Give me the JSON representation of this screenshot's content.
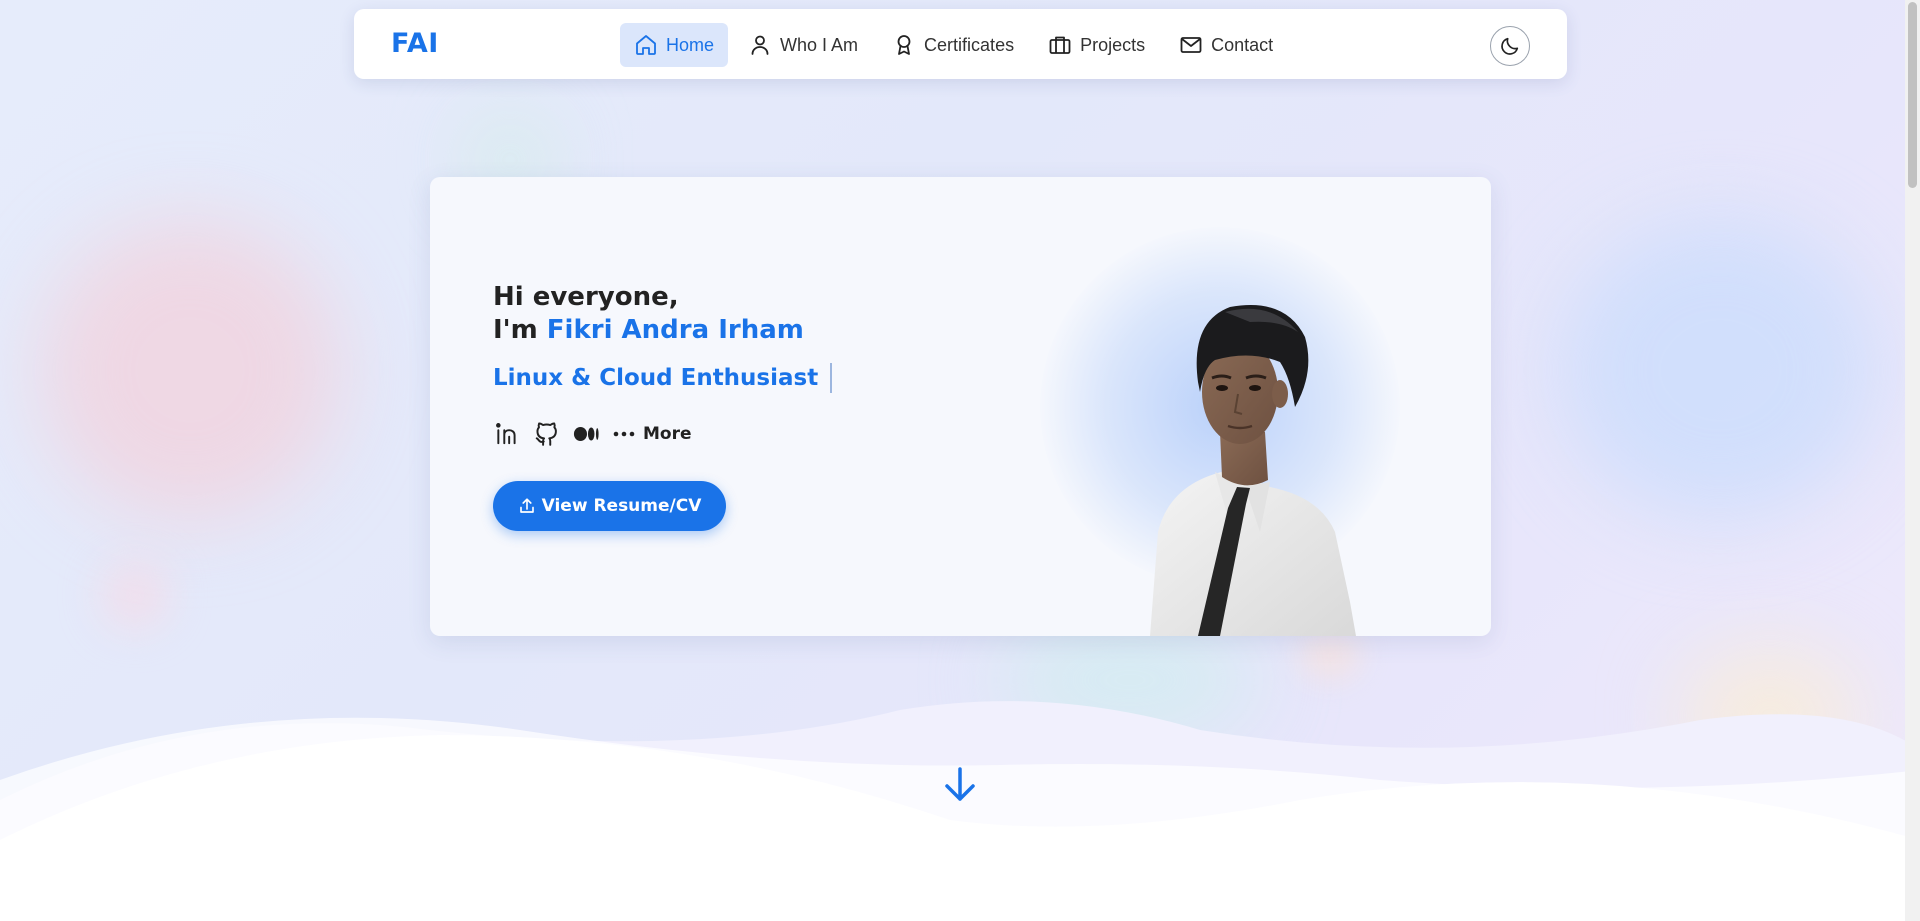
{
  "brand": "FAI",
  "nav": {
    "items": [
      {
        "label": "Home",
        "icon": "home-icon",
        "active": true
      },
      {
        "label": "Who I Am",
        "icon": "user-icon",
        "active": false
      },
      {
        "label": "Certificates",
        "icon": "award-icon",
        "active": false
      },
      {
        "label": "Projects",
        "icon": "briefcase-icon",
        "active": false
      },
      {
        "label": "Contact",
        "icon": "mail-icon",
        "active": false
      }
    ],
    "theme_toggle_icon": "moon-icon"
  },
  "hero": {
    "greeting_line1": "Hi everyone,",
    "greeting_prefix": "I'm",
    "name": "Fikri Andra Irham",
    "role": "Linux & Cloud Enthusiast",
    "socials": [
      "linkedin-icon",
      "github-icon",
      "medium-icon"
    ],
    "more_label": "More",
    "cv_button_label": "View Resume/CV"
  },
  "colors": {
    "accent": "#1a73e8",
    "text": "#222222",
    "card": "#f6f8fd"
  }
}
